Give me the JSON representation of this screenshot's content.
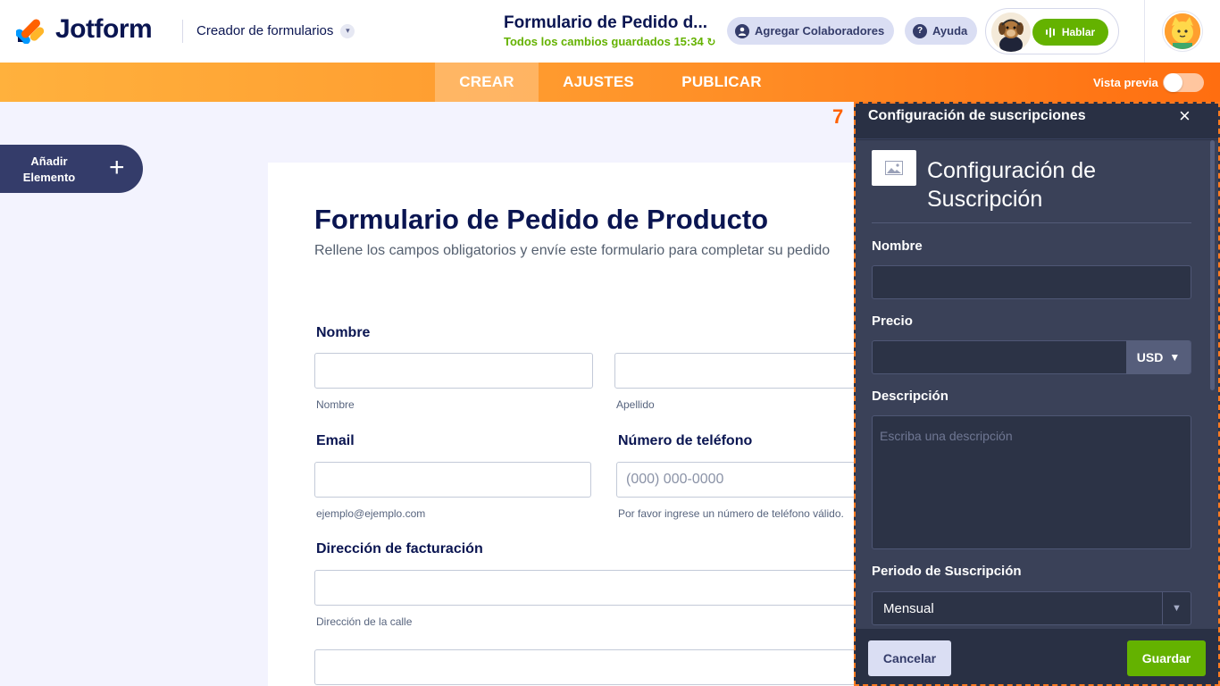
{
  "header": {
    "brand": "Jotform",
    "builder_label": "Creador de formularios",
    "form_title_short": "Formulario de Pedido d...",
    "saved_status": "Todos los cambios guardados 15:34",
    "collab_label": "Agregar Colaboradores",
    "help_label": "Ayuda",
    "talk_label": "Hablar"
  },
  "nav": {
    "tabs": [
      {
        "label": "CREAR",
        "active": true
      },
      {
        "label": "AJUSTES",
        "active": false
      },
      {
        "label": "PUBLICAR",
        "active": false
      }
    ],
    "preview_label": "Vista previa"
  },
  "sidebar": {
    "add_element_label": "Añadir Elemento"
  },
  "form": {
    "title": "Formulario de Pedido de Producto",
    "subtitle": "Rellene los campos obligatorios y envíe este formulario para completar su pedido",
    "name_label": "Nombre",
    "first_name_help": "Nombre",
    "last_name_help": "Apellido",
    "email_label": "Email",
    "email_help": "ejemplo@ejemplo.com",
    "phone_label": "Número de teléfono",
    "phone_placeholder": "(000) 000-0000",
    "phone_help": "Por favor ingrese un número de teléfono válido.",
    "billing_label": "Dirección de facturación",
    "street_help": "Dirección de la calle"
  },
  "panel": {
    "step_number": "7",
    "header_title": "Configuración de suscripciones",
    "big_title": "Configuración de Suscripción",
    "name_label": "Nombre",
    "price_label": "Precio",
    "currency": "USD",
    "description_label": "Descripción",
    "description_placeholder": "Escriba una descripción",
    "period_label": "Periodo de Suscripción",
    "period_value": "Mensual",
    "cancel_label": "Cancelar",
    "save_label": "Guardar"
  },
  "colors": {
    "brand_navy": "#0a1551",
    "accent_orange": "#ff6100",
    "accent_green": "#64b200",
    "panel_bg": "#2b3245"
  }
}
